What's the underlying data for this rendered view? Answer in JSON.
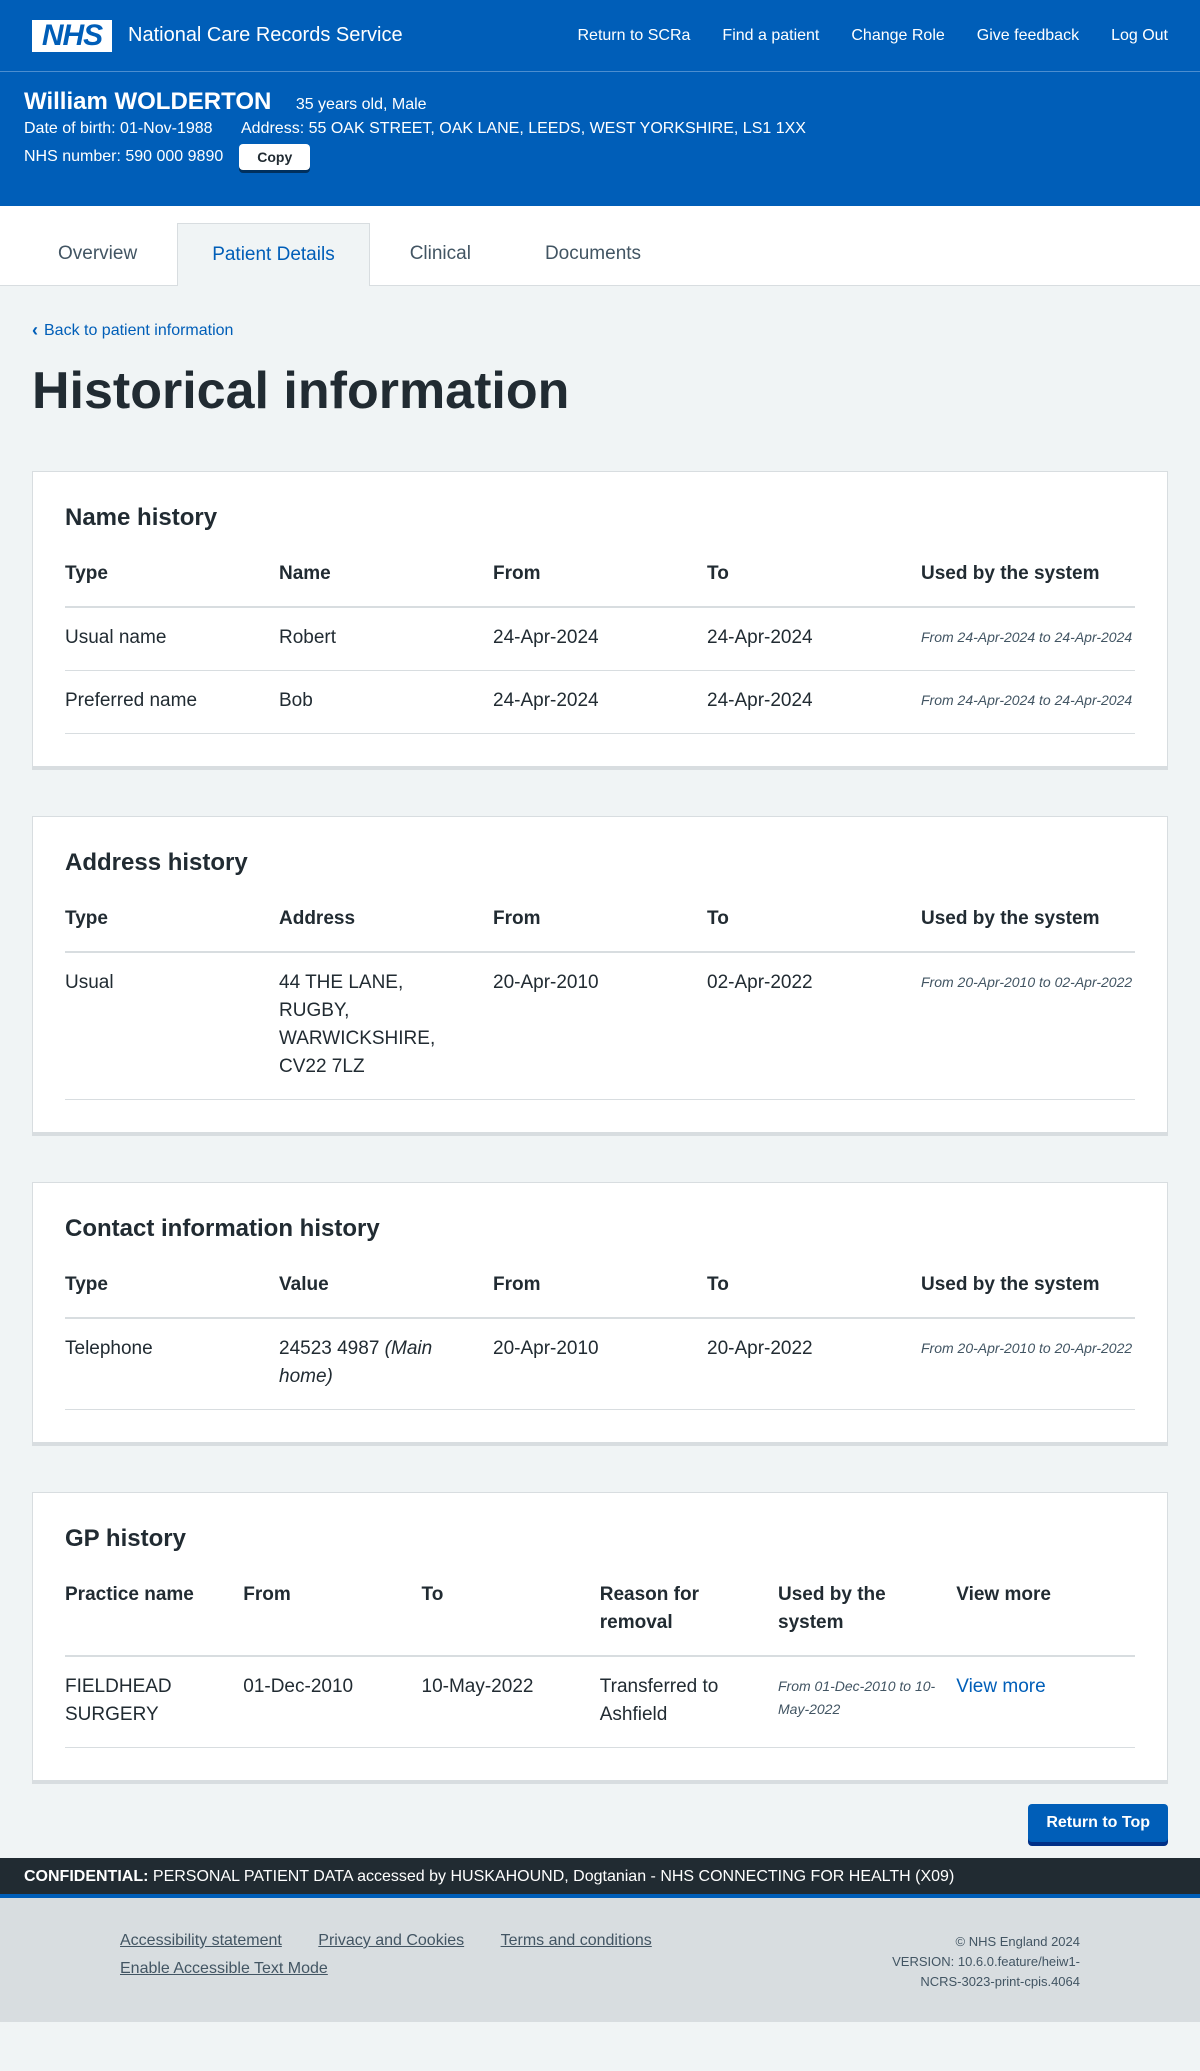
{
  "header": {
    "logo": "NHS",
    "service_name": "National Care Records Service",
    "nav": [
      "Return to SCRa",
      "Find a patient",
      "Change Role",
      "Give feedback",
      "Log Out"
    ]
  },
  "patient": {
    "name": "William WOLDERTON",
    "age_sex": "35 years old, Male",
    "dob": "Date of birth: 01-Nov-1988",
    "address": "Address: 55 OAK STREET, OAK LANE, LEEDS, WEST YORKSHIRE, LS1 1XX",
    "nhs_number": "NHS number: 590 000 9890",
    "copy_label": "Copy"
  },
  "tabs": [
    "Overview",
    "Patient Details",
    "Clinical",
    "Documents"
  ],
  "back_link": "Back to patient information",
  "page_title": "Historical information",
  "name_history": {
    "title": "Name history",
    "headers": [
      "Type",
      "Name",
      "From",
      "To",
      "Used by the system"
    ],
    "rows": [
      [
        "Usual name",
        "Robert",
        "24-Apr-2024",
        "24-Apr-2024",
        "From 24-Apr-2024 to 24-Apr-2024"
      ],
      [
        "Preferred name",
        "Bob",
        "24-Apr-2024",
        "24-Apr-2024",
        "From 24-Apr-2024 to 24-Apr-2024"
      ]
    ]
  },
  "address_history": {
    "title": "Address history",
    "headers": [
      "Type",
      "Address",
      "From",
      "To",
      "Used by the system"
    ],
    "rows": [
      [
        "Usual",
        "44 THE LANE, RUGBY, WARWICKSHIRE, CV22 7LZ",
        "20-Apr-2010",
        "02-Apr-2022",
        "From 20-Apr-2010 to 02-Apr-2022"
      ]
    ]
  },
  "contact_history": {
    "title": "Contact information history",
    "headers": [
      "Type",
      "Value",
      "From",
      "To",
      "Used by the system"
    ],
    "rows": [
      {
        "type": "Telephone",
        "value": "24523 4987",
        "value_note": "(Main home)",
        "from": "20-Apr-2010",
        "to": "20-Apr-2022",
        "used": "From 20-Apr-2010 to 20-Apr-2022"
      }
    ]
  },
  "gp_history": {
    "title": "GP history",
    "headers": [
      "Practice name",
      "From",
      "To",
      "Reason for removal",
      "Used by the system",
      "View more"
    ],
    "rows": [
      [
        "FIELDHEAD SURGERY",
        "01-Dec-2010",
        "10-May-2022",
        "Transferred to Ashfield",
        "From 01-Dec-2010 to 10-May-2022",
        "View more"
      ]
    ]
  },
  "return_to_top": "Return to Top",
  "confidential": {
    "label": "CONFIDENTIAL:",
    "text": "PERSONAL PATIENT DATA accessed by HUSKAHOUND, Dogtanian - NHS CONNECTING FOR HEALTH (X09)"
  },
  "footer": {
    "links": [
      "Accessibility statement",
      "Privacy and Cookies",
      "Terms and conditions",
      "Enable Accessible Text Mode"
    ],
    "copyright": "© NHS England 2024",
    "version_line1": "VERSION: 10.6.0.feature/heiw1-",
    "version_line2": "NCRS-3023-print-cpis.4064"
  },
  "colors": {
    "primary": "#005eb8",
    "text": "#212b32",
    "background": "#f0f4f5",
    "footer": "#d8dde0"
  }
}
